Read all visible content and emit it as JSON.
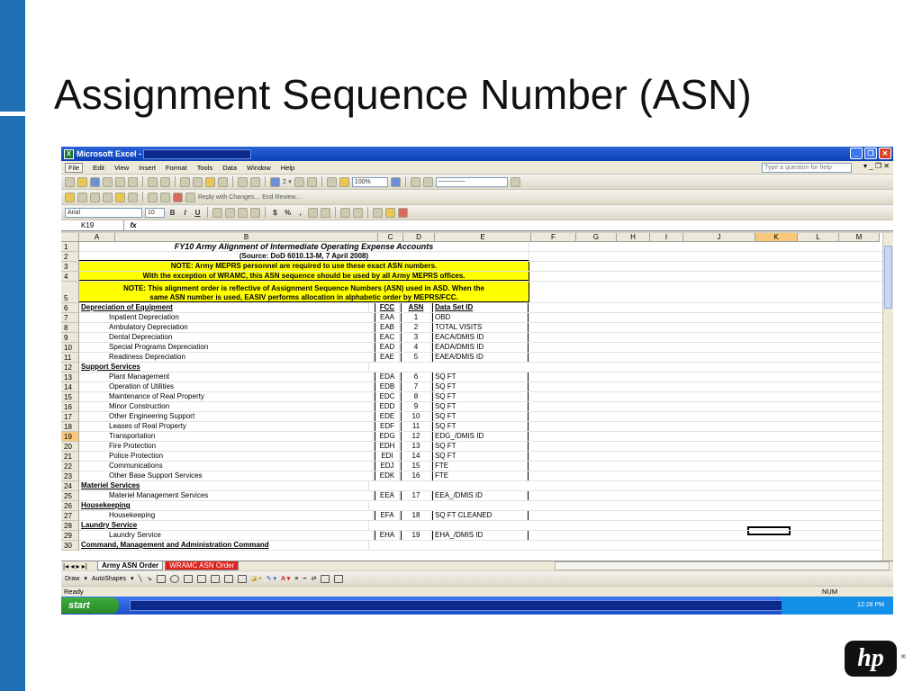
{
  "slide": {
    "title": "Assignment Sequence Number (ASN)",
    "logo_text": "hp"
  },
  "excel": {
    "window_title": "Microsoft Excel - ",
    "menu": [
      "File",
      "Edit",
      "View",
      "Insert",
      "Format",
      "Tools",
      "Data",
      "Window",
      "Help"
    ],
    "help_placeholder": "Type a question for help",
    "zoom": "100%",
    "reviewing": [
      "Reply with Changes...",
      "End Review..."
    ],
    "font_name": "Arial",
    "font_size": "10",
    "name_box": "K19",
    "fx_label": "fx",
    "columns": [
      "A",
      "B",
      "C",
      "D",
      "E",
      "F",
      "G",
      "H",
      "I",
      "J",
      "K",
      "L",
      "M"
    ],
    "selected_column": "K",
    "selected_row": "19",
    "sheet_title": "FY10 Army Alignment of Intermediate Operating Expense Accounts",
    "sheet_source": "(Source: DoD 6010.13-M, 7 April 2008)",
    "note1_line1": "NOTE: Army MEPRS personnel are required to use these exact ASN numbers.",
    "note1_line2": "With the exception of WRAMC, this ASN sequence should be used by all Army MEPRS offices.",
    "note2_line1": "NOTE: This alignment order is reflective of Assignment Sequence Numbers (ASN) used in ASD.  When the",
    "note2_line2": "same ASN number is used, EASIV performs allocation in alphabetic order by MEPRS/FCC.",
    "header_row": {
      "label": "Depreciation of Equipment",
      "fcc": "FCC",
      "asn": "ASN",
      "dsid": "Data Set ID"
    },
    "rows": [
      {
        "n": "7",
        "desc": "Inpatient Depreciation",
        "fcc": "EAA",
        "asn": "1",
        "dsid": "OBD"
      },
      {
        "n": "8",
        "desc": "Ambulatory Depreciation",
        "fcc": "EAB",
        "asn": "2",
        "dsid": "TOTAL VISITS"
      },
      {
        "n": "9",
        "desc": "Dental Depreciation",
        "fcc": "EAC",
        "asn": "3",
        "dsid": "EACA/DMIS ID"
      },
      {
        "n": "10",
        "desc": "Special Programs Depreciation",
        "fcc": "EAD",
        "asn": "4",
        "dsid": "EADA/DMIS ID"
      },
      {
        "n": "11",
        "desc": "Readiness Depreciation",
        "fcc": "EAE",
        "asn": "5",
        "dsid": "EAEA/DMIS ID"
      },
      {
        "n": "12",
        "section": "Support Services"
      },
      {
        "n": "13",
        "desc": "Plant Management",
        "fcc": "EDA",
        "asn": "6",
        "dsid": "SQ FT"
      },
      {
        "n": "14",
        "desc": "Operation of Utilities",
        "fcc": "EDB",
        "asn": "7",
        "dsid": "SQ FT"
      },
      {
        "n": "15",
        "desc": "Maintenance of Real Property",
        "fcc": "EDC",
        "asn": "8",
        "dsid": "SQ FT"
      },
      {
        "n": "16",
        "desc": "Minor Construction",
        "fcc": "EDD",
        "asn": "9",
        "dsid": "SQ FT"
      },
      {
        "n": "17",
        "desc": "Other Engineering Support",
        "fcc": "EDE",
        "asn": "10",
        "dsid": "SQ FT"
      },
      {
        "n": "18",
        "desc": "Leases of Real Property",
        "fcc": "EDF",
        "asn": "11",
        "dsid": "SQ FT"
      },
      {
        "n": "19",
        "desc": "Transportation",
        "fcc": "EDG",
        "asn": "12",
        "dsid": "EDG_/DMIS ID"
      },
      {
        "n": "20",
        "desc": "Fire Protection",
        "fcc": "EDH",
        "asn": "13",
        "dsid": "SQ FT"
      },
      {
        "n": "21",
        "desc": "Police Protection",
        "fcc": "EDI",
        "asn": "14",
        "dsid": "SQ FT"
      },
      {
        "n": "22",
        "desc": "Communications",
        "fcc": "EDJ",
        "asn": "15",
        "dsid": "FTE"
      },
      {
        "n": "23",
        "desc": "Other Base Support Services",
        "fcc": "EDK",
        "asn": "16",
        "dsid": "FTE"
      },
      {
        "n": "24",
        "section": "Materiel Services"
      },
      {
        "n": "25",
        "desc": "Materiel Management Services",
        "fcc": "EEA",
        "asn": "17",
        "dsid": "EEA_/DMIS ID"
      },
      {
        "n": "26",
        "section": "Housekeeping"
      },
      {
        "n": "27",
        "desc": "Housekeeping",
        "fcc": "EFA",
        "asn": "18",
        "dsid": "SQ FT CLEANED"
      },
      {
        "n": "28",
        "section": "Laundry Service"
      },
      {
        "n": "29",
        "desc": "Laundry Service",
        "fcc": "EHA",
        "asn": "19",
        "dsid": "EHA_/DMIS ID"
      },
      {
        "n": "30",
        "section": "Command, Management and Administration Command"
      }
    ],
    "tabs": [
      "Army ASN Order",
      "WRAMC ASN Order"
    ],
    "draw_label": "Draw",
    "autoshapes_label": "AutoShapes",
    "status": "Ready",
    "num_indicator": "NUM",
    "start_label": "start",
    "clock": "12:28 PM"
  }
}
